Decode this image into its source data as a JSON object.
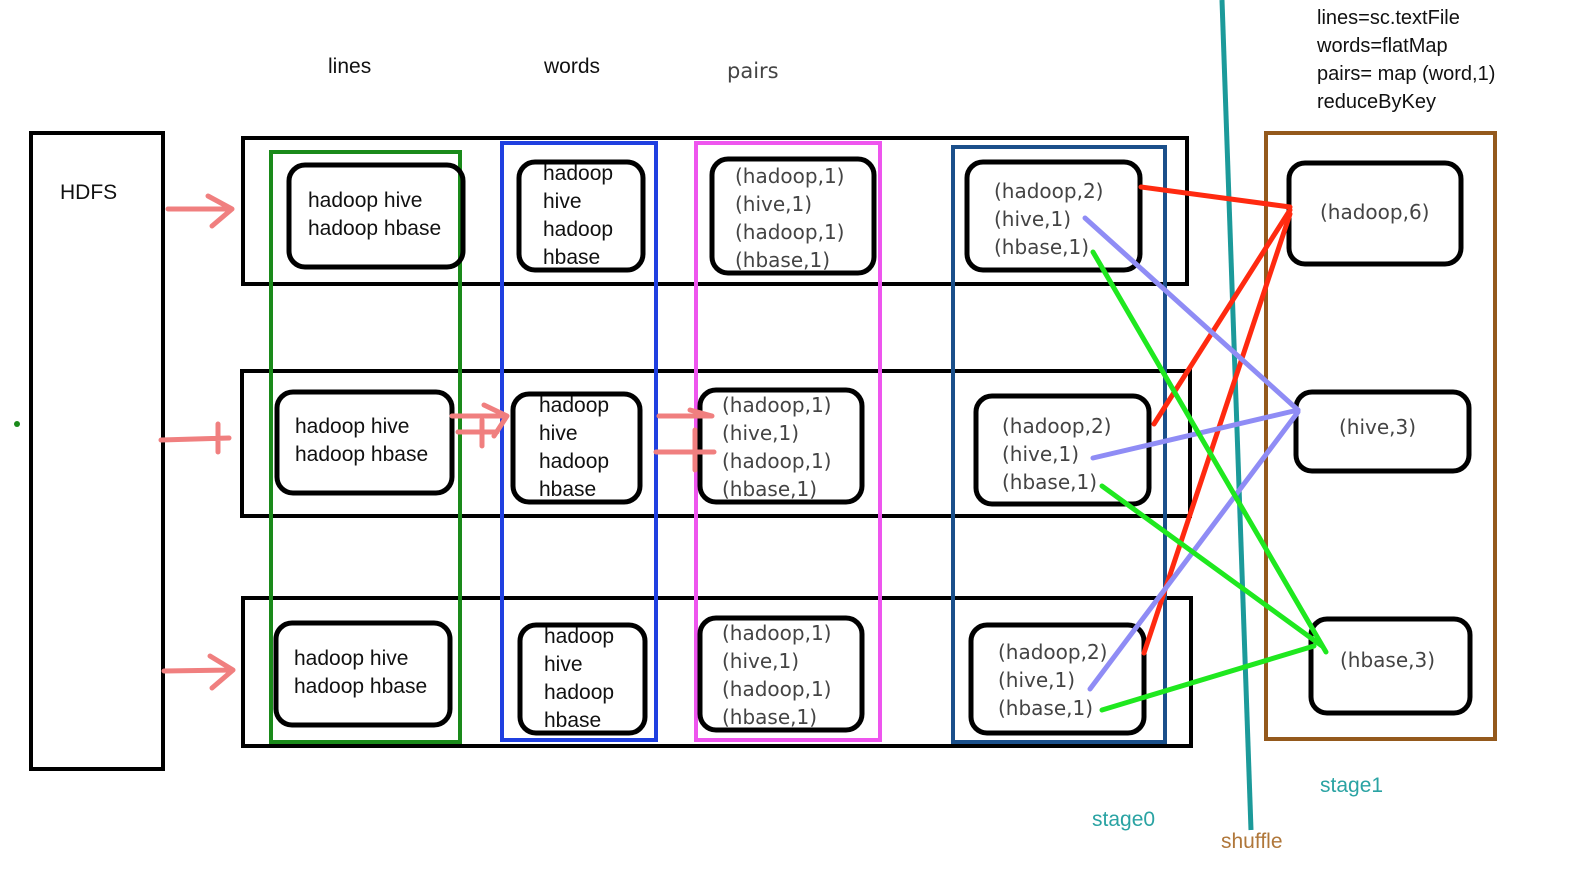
{
  "source": {
    "label": "HDFS"
  },
  "column_headers": {
    "lines": "lines",
    "words": "words",
    "pairs": "pairs"
  },
  "code_notes": [
    "lines=sc.textFile",
    "words=flatMap",
    "pairs= map (word,1)",
    "reduceByKey"
  ],
  "partitions": [
    {
      "lines": [
        "hadoop hive",
        "hadoop hbase"
      ],
      "words": [
        "hadoop",
        "hive",
        "hadoop",
        "hbase"
      ],
      "pairs": [
        "(hadoop,1)",
        "(hive,1)",
        "(hadoop,1)",
        "(hbase,1)"
      ],
      "combined": [
        "(hadoop,2)",
        "(hive,1)",
        "(hbase,1)"
      ]
    },
    {
      "lines": [
        "hadoop hive",
        "hadoop hbase"
      ],
      "words": [
        "hadoop",
        "hive",
        "hadoop",
        "hbase"
      ],
      "pairs": [
        "(hadoop,1)",
        "(hive,1)",
        "(hadoop,1)",
        "(hbase,1)"
      ],
      "combined": [
        "(hadoop,2)",
        "(hive,1)",
        "(hbase,1)"
      ]
    },
    {
      "lines": [
        "hadoop hive",
        "hadoop hbase"
      ],
      "words": [
        "hadoop",
        "hive",
        "hadoop",
        "hbase"
      ],
      "pairs": [
        "(hadoop,1)",
        "(hive,1)",
        "(hadoop,1)",
        "(hbase,1)"
      ],
      "combined": [
        "(hadoop,2)",
        "(hive,1)",
        "(hbase,1)"
      ]
    }
  ],
  "results": [
    "(hadoop,6)",
    "(hive,3)",
    "(hbase,3)"
  ],
  "labels": {
    "stage0": "stage0",
    "stage1": "stage1",
    "shuffle": "shuffle"
  },
  "colors": {
    "lines_column": "#1a8a1a",
    "words_column": "#1f3fe0",
    "pairs_column": "#ee55ee",
    "combine_column": "#1a4f8a",
    "stage1_box": "#94591c",
    "shuffle_line": "#1c9a9a",
    "hadoop_edge": "#ff2a10",
    "hive_edge": "#8f8cf5",
    "hbase_edge": "#1fe81f",
    "arrow": "#f07f7f"
  }
}
